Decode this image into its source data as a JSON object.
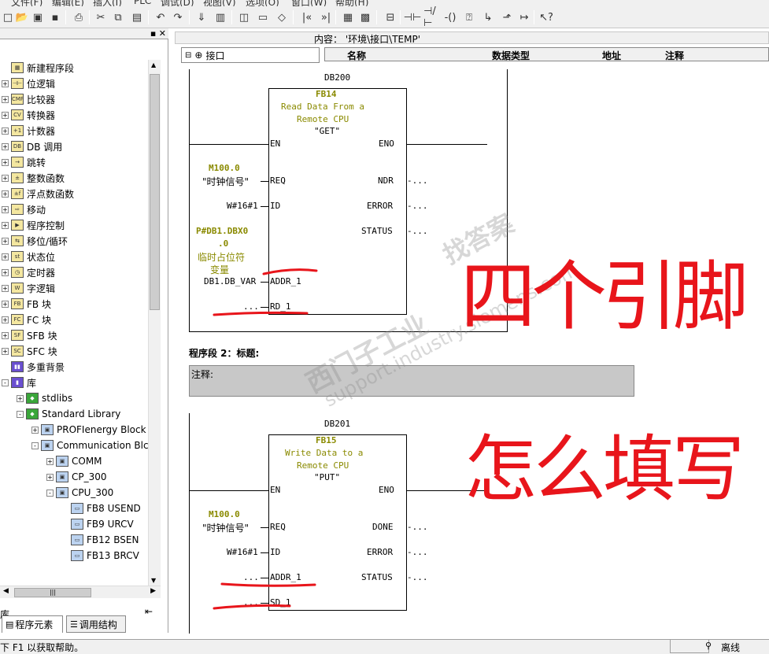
{
  "menu": [
    "文件(F)",
    "编辑(E)",
    "插入(I)",
    "PLC",
    "调试(D)",
    "视图(V)",
    "选项(O)",
    "窗口(W)",
    "帮助(H)"
  ],
  "tree": [
    {
      "label": "新建程序段",
      "icon": "network-icon",
      "indent": 0,
      "expand": ""
    },
    {
      "label": "位逻辑",
      "icon": "bit-logic-icon",
      "indent": 0,
      "expand": "+"
    },
    {
      "label": "比较器",
      "icon": "comparator-icon",
      "indent": 0,
      "expand": "+"
    },
    {
      "label": "转换器",
      "icon": "converter-icon",
      "indent": 0,
      "expand": "+"
    },
    {
      "label": "计数器",
      "icon": "counter-icon",
      "indent": 0,
      "expand": "+"
    },
    {
      "label": "DB 调用",
      "icon": "db-call-icon",
      "indent": 0,
      "expand": "+"
    },
    {
      "label": "跳转",
      "icon": "jump-icon",
      "indent": 0,
      "expand": "+"
    },
    {
      "label": "整数函数",
      "icon": "integer-function-icon",
      "indent": 0,
      "expand": "+"
    },
    {
      "label": "浮点数函数",
      "icon": "float-function-icon",
      "indent": 0,
      "expand": "+"
    },
    {
      "label": "移动",
      "icon": "move-icon",
      "indent": 0,
      "expand": "+"
    },
    {
      "label": "程序控制",
      "icon": "program-control-icon",
      "indent": 0,
      "expand": "+"
    },
    {
      "label": "移位/循环",
      "icon": "shift-rotate-icon",
      "indent": 0,
      "expand": "+"
    },
    {
      "label": "状态位",
      "icon": "status-bit-icon",
      "indent": 0,
      "expand": "+"
    },
    {
      "label": "定时器",
      "icon": "timer-icon",
      "indent": 0,
      "expand": "+"
    },
    {
      "label": "字逻辑",
      "icon": "word-logic-icon",
      "indent": 0,
      "expand": "+"
    },
    {
      "label": "FB 块",
      "icon": "fb-block-icon",
      "indent": 0,
      "expand": "+"
    },
    {
      "label": "FC 块",
      "icon": "fc-block-icon",
      "indent": 0,
      "expand": "+"
    },
    {
      "label": "SFB 块",
      "icon": "sfb-block-icon",
      "indent": 0,
      "expand": "+"
    },
    {
      "label": "SFC 块",
      "icon": "sfc-block-icon",
      "indent": 0,
      "expand": "+"
    },
    {
      "label": "多重背景",
      "icon": "multi-instance-icon",
      "indent": 0,
      "expand": ""
    },
    {
      "label": "库",
      "icon": "library-icon",
      "indent": 0,
      "expand": "-"
    },
    {
      "label": "stdlibs",
      "icon": "lib-green-icon",
      "indent": 1,
      "expand": "+"
    },
    {
      "label": "Standard Library",
      "icon": "lib-green-icon",
      "indent": 1,
      "expand": "-"
    },
    {
      "label": "PROFIenergy Block",
      "icon": "folder-block-icon",
      "indent": 2,
      "expand": "+"
    },
    {
      "label": "Communication Blc",
      "icon": "folder-block-icon",
      "indent": 2,
      "expand": "-"
    },
    {
      "label": "COMM",
      "icon": "folder-block-icon",
      "indent": 3,
      "expand": "+"
    },
    {
      "label": "CP_300",
      "icon": "folder-block-icon",
      "indent": 3,
      "expand": "+"
    },
    {
      "label": "CPU_300",
      "icon": "folder-block-icon",
      "indent": 3,
      "expand": "-"
    },
    {
      "label": "FB8  USEND",
      "icon": "block-icon",
      "indent": 4,
      "expand": ""
    },
    {
      "label": "FB9  URCV",
      "icon": "block-icon",
      "indent": 4,
      "expand": ""
    },
    {
      "label": "FB12  BSEN",
      "icon": "block-icon",
      "indent": 4,
      "expand": ""
    },
    {
      "label": "FB13  BRCV",
      "icon": "block-icon",
      "indent": 4,
      "expand": ""
    }
  ],
  "left_lib_label": "库",
  "tabs": {
    "program_elements": "程序元素",
    "call_structure": "调用结构"
  },
  "content_path": "内容： '环境\\接口\\TEMP'",
  "interface_label": "接口",
  "columns": {
    "name": "名称",
    "datatype": "数据类型",
    "address": "地址",
    "comment": "注释"
  },
  "net1": {
    "db": "DB200",
    "fb": "FB14",
    "desc1": "Read Data From a",
    "desc2": "Remote CPU",
    "sym": "\"GET\"",
    "en": "EN",
    "eno": "ENO",
    "req": "REQ",
    "id": "ID",
    "addr": "ADDR_1",
    "rd": "RD_1",
    "ndr": "NDR",
    "error": "ERROR",
    "status": "STATUS",
    "m100": "M100.0",
    "clock": "\"时钟信号\"",
    "w16": "W#16#1",
    "p_db1": "P#DB1.DBX0",
    ".0": ".0",
    "tmp1": "临时占位符",
    "tmp2": "变量",
    "db1var": "DB1.DB_VAR",
    "dots": "..."
  },
  "net2_title": "程序段 2：标题:",
  "net2_comment": "注释:",
  "net2": {
    "db": "DB201",
    "fb": "FB15",
    "desc1": "Write Data to a",
    "desc2": "Remote CPU",
    "sym": "\"PUT\"",
    "en": "EN",
    "eno": "ENO",
    "req": "REQ",
    "id": "ID",
    "addr": "ADDR_1",
    "sd": "SD_1",
    "done": "DONE",
    "error": "ERROR",
    "status": "STATUS",
    "m100": "M100.0",
    "clock": "\"时钟信号\"",
    "w16": "W#16#1",
    "dots": "..."
  },
  "status": {
    "help": "下 F1 以获取帮助。",
    "offline": "离线"
  },
  "watermark": {
    "line1": "西门子工业",
    "line2": "support.industry.siemens.com",
    "line3": "找答案"
  },
  "annotations": {
    "top": "四个引脚",
    "bottom": "怎么填写"
  },
  "colors": {
    "annotation": "#e8151b",
    "olive": "#8a8a00"
  }
}
